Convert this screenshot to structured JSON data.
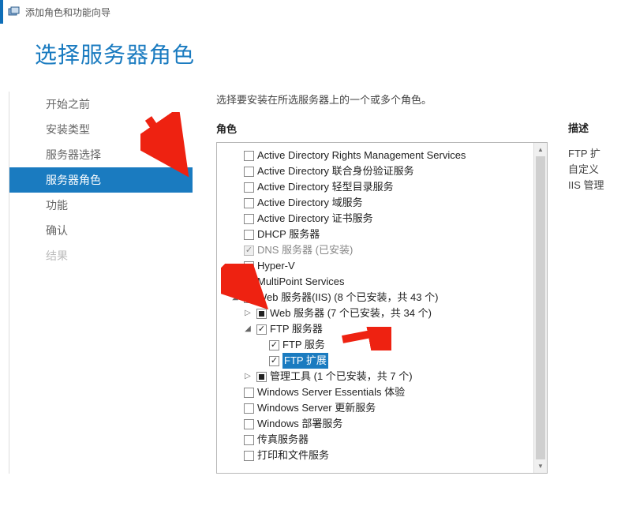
{
  "window": {
    "title": "添加角色和功能向导"
  },
  "page_title": "选择服务器角色",
  "instruction": "选择要安装在所选服务器上的一个或多个角色。",
  "roles_label": "角色",
  "description_label": "描述",
  "description_lines": [
    "FTP 扩",
    "自定义",
    "IIS 管理"
  ],
  "sidebar": {
    "items": [
      {
        "label": "开始之前",
        "state": "normal"
      },
      {
        "label": "安装类型",
        "state": "normal"
      },
      {
        "label": "服务器选择",
        "state": "normal"
      },
      {
        "label": "服务器角色",
        "state": "active"
      },
      {
        "label": "功能",
        "state": "normal"
      },
      {
        "label": "确认",
        "state": "normal"
      },
      {
        "label": "结果",
        "state": "disabled"
      }
    ]
  },
  "tree": [
    {
      "indent": 0,
      "exp": "blank",
      "check": "none",
      "label": "Active Directory Rights Management Services"
    },
    {
      "indent": 0,
      "exp": "blank",
      "check": "none",
      "label": "Active Directory 联合身份验证服务"
    },
    {
      "indent": 0,
      "exp": "blank",
      "check": "none",
      "label": "Active Directory 轻型目录服务"
    },
    {
      "indent": 0,
      "exp": "blank",
      "check": "none",
      "label": "Active Directory 域服务"
    },
    {
      "indent": 0,
      "exp": "blank",
      "check": "none",
      "label": "Active Directory 证书服务"
    },
    {
      "indent": 0,
      "exp": "blank",
      "check": "none",
      "label": "DHCP 服务器"
    },
    {
      "indent": 0,
      "exp": "blank",
      "check": "checked-disabled",
      "label": "DNS 服务器 (已安装)",
      "disabled": true
    },
    {
      "indent": 0,
      "exp": "blank",
      "check": "none",
      "label": "Hyper-V"
    },
    {
      "indent": 0,
      "exp": "blank",
      "check": "none",
      "label": "MultiPoint Services"
    },
    {
      "indent": 1,
      "exp": "open",
      "check": "partial",
      "label": "Web 服务器(IIS) (8 个已安装，共 43 个)"
    },
    {
      "indent": 2,
      "exp": "closed",
      "check": "partial",
      "label": "Web 服务器 (7 个已安装，共 34 个)"
    },
    {
      "indent": 2,
      "exp": "open",
      "check": "checked",
      "label": "FTP 服务器"
    },
    {
      "indent": 3,
      "exp": "blank",
      "check": "checked",
      "label": "FTP 服务"
    },
    {
      "indent": 3,
      "exp": "blank",
      "check": "checked",
      "label": "FTP 扩展",
      "highlight": true
    },
    {
      "indent": 2,
      "exp": "closed",
      "check": "partial",
      "label": "管理工具 (1 个已安装，共 7 个)"
    },
    {
      "indent": 0,
      "exp": "blank",
      "check": "none",
      "label": "Windows Server Essentials 体验"
    },
    {
      "indent": 0,
      "exp": "blank",
      "check": "none",
      "label": "Windows Server 更新服务"
    },
    {
      "indent": 0,
      "exp": "blank",
      "check": "none",
      "label": "Windows 部署服务"
    },
    {
      "indent": 0,
      "exp": "blank",
      "check": "none",
      "label": "传真服务器"
    },
    {
      "indent": 0,
      "exp": "blank",
      "check": "none",
      "label": "打印和文件服务"
    }
  ]
}
